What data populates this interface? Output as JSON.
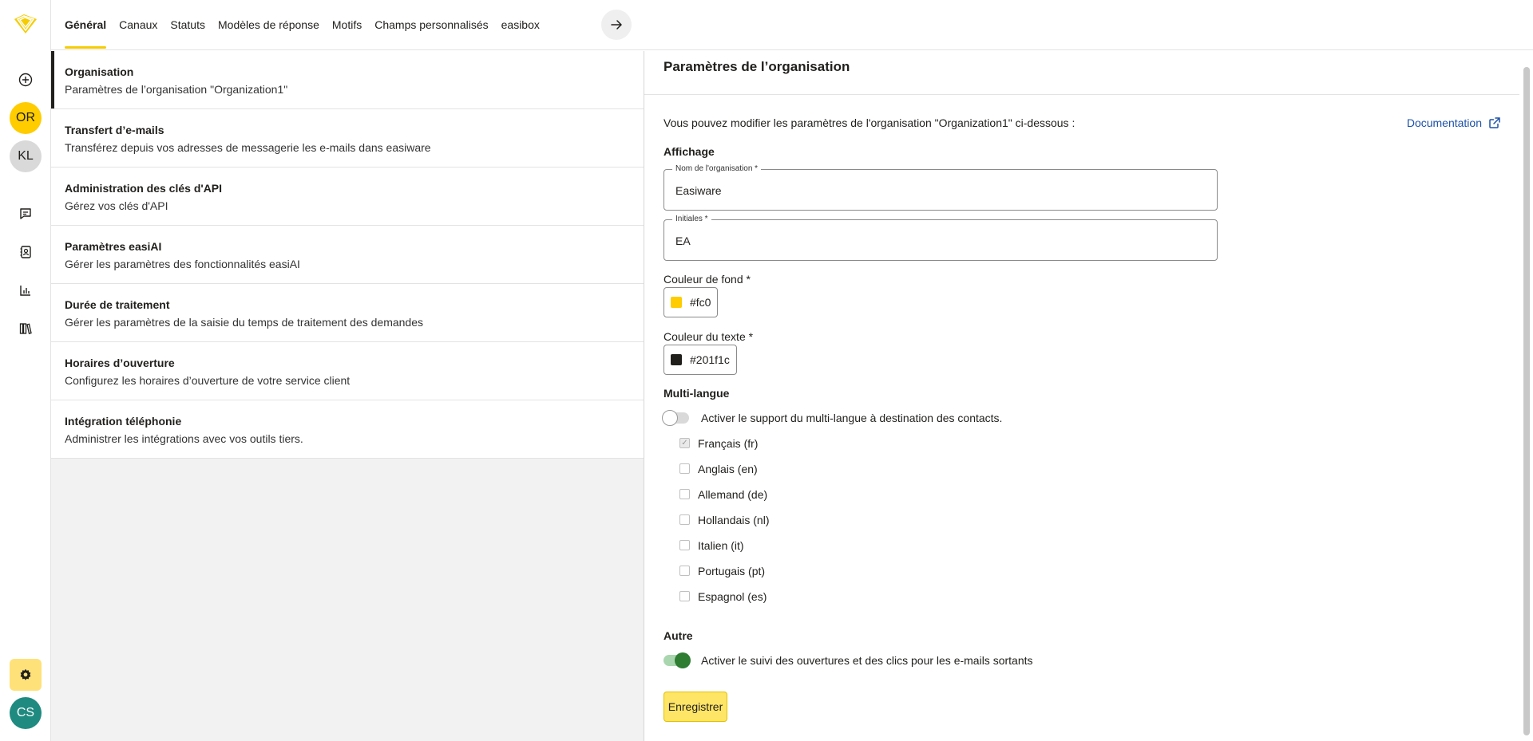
{
  "tabs": [
    {
      "label": "Général",
      "active": true
    },
    {
      "label": "Canaux"
    },
    {
      "label": "Statuts"
    },
    {
      "label": "Modèles de réponse"
    },
    {
      "label": "Motifs"
    },
    {
      "label": "Champs personnalisés"
    },
    {
      "label": "easibox"
    }
  ],
  "rail": {
    "avatars": [
      {
        "initials": "OR",
        "bg": "#ffcc00"
      },
      {
        "initials": "KL",
        "bg": "#d9d9d9"
      }
    ],
    "user": {
      "initials": "CS",
      "bg": "#1f8a80"
    }
  },
  "settings_list": [
    {
      "title": "Organisation",
      "desc": "Paramètres de l’organisation \"Organization1\"",
      "active": true
    },
    {
      "title": "Transfert d’e-mails",
      "desc": "Transférez depuis vos adresses de messagerie les e-mails dans easiware"
    },
    {
      "title": "Administration des clés d'API",
      "desc": "Gérez vos clés d'API"
    },
    {
      "title": "Paramètres easiAI",
      "desc": "Gérer les paramètres des fonctionnalités easiAI"
    },
    {
      "title": "Durée de traitement",
      "desc": "Gérer les paramètres de la saisie du temps de traitement des demandes"
    },
    {
      "title": "Horaires d’ouverture",
      "desc": "Configurez les horaires d’ouverture de votre service client"
    },
    {
      "title": "Intégration téléphonie",
      "desc": "Administrer les intégrations avec vos outils tiers."
    }
  ],
  "panel": {
    "title": "Paramètres de l’organisation",
    "intro": "Vous pouvez modifier les paramètres de l'organisation \"Organization1\" ci-dessous :",
    "doc_link": "Documentation",
    "display_heading": "Affichage",
    "org_name_label": "Nom de l'organisation *",
    "org_name_value": "Easiware",
    "initials_label": "Initiales *",
    "initials_value": "EA",
    "bg_color_label": "Couleur de fond *",
    "bg_color_value": "#fc0",
    "text_color_label": "Couleur du texte *",
    "text_color_value": "#201f1c",
    "multilang_heading": "Multi-langue",
    "multilang_toggle_label": "Activer le support du multi-langue à destination des contacts.",
    "languages": [
      {
        "label": "Français (fr)",
        "checked": true
      },
      {
        "label": "Anglais (en)",
        "checked": false
      },
      {
        "label": "Allemand (de)",
        "checked": false
      },
      {
        "label": "Hollandais (nl)",
        "checked": false
      },
      {
        "label": "Italien (it)",
        "checked": false
      },
      {
        "label": "Portugais (pt)",
        "checked": false
      },
      {
        "label": "Espagnol (es)",
        "checked": false
      }
    ],
    "other_heading": "Autre",
    "tracking_toggle_label": "Activer le suivi des ouvertures et des clics pour les e-mails sortants",
    "save_label": "Enregistrer"
  },
  "colors": {
    "accent": "#f5cc00",
    "link": "#1d52a8",
    "toggle_on": "#2e7d32"
  }
}
